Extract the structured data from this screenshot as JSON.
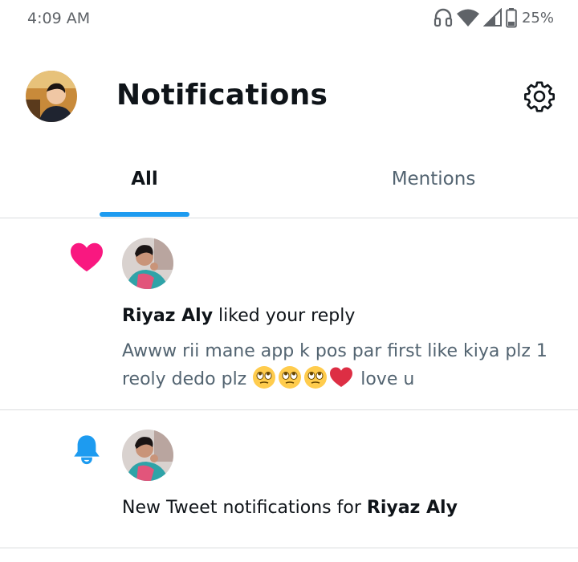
{
  "status_bar": {
    "time": "4:09 AM",
    "battery": "25%",
    "icons": [
      "headphones-icon",
      "wifi-icon",
      "signal-icon",
      "battery-icon"
    ]
  },
  "header": {
    "title": "Notifications",
    "settings_icon": "gear-icon"
  },
  "tabs": [
    {
      "label": "All",
      "active": true
    },
    {
      "label": "Mentions",
      "active": false
    }
  ],
  "notifications": [
    {
      "type": "like",
      "icon": "heart-icon",
      "user": "Riyaz Aly",
      "action": " liked your reply",
      "body_text": "Awww rii mane app k pos par first like kiya plz 1 reoly dedo plz",
      "body_emojis": [
        "rolling-eyes-emoji",
        "rolling-eyes-emoji",
        "rolling-eyes-emoji",
        "red-heart-emoji"
      ],
      "body_suffix": " love u"
    },
    {
      "type": "new_tweet",
      "icon": "bell-icon",
      "prefix": "New Tweet notifications for ",
      "user": "Riyaz Aly"
    }
  ],
  "colors": {
    "accent": "#1d9bf0",
    "like": "#f91880",
    "text_primary": "#0f1419",
    "text_secondary": "#536471"
  }
}
